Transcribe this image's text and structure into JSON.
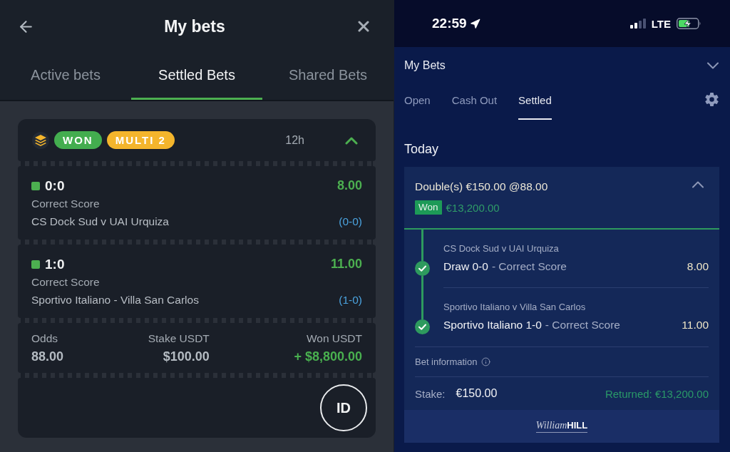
{
  "left_app": {
    "header": {
      "title": "My bets"
    },
    "tabs": [
      {
        "label": "Active bets",
        "selected": false
      },
      {
        "label": "Settled Bets",
        "selected": true
      },
      {
        "label": "Shared Bets",
        "selected": false
      }
    ],
    "bet_card": {
      "badges": [
        {
          "label": "WON",
          "color": "#43ad4f"
        },
        {
          "label": "MULTI 2",
          "color": "#f4b52c"
        }
      ],
      "time": "12h",
      "expanded": true,
      "selections": [
        {
          "pick": "0:0",
          "odds": "8.00",
          "market": "Correct Score",
          "event": "CS Dock Sud v UAI Urquiza",
          "result": "(0-0)"
        },
        {
          "pick": "1:0",
          "odds": "11.00",
          "market": "Correct Score",
          "event": "Sportivo Italiano - Villa San Carlos",
          "result": "(1-0)"
        }
      ],
      "summary": [
        {
          "label": "Odds",
          "value": "88.00",
          "kind": "plain"
        },
        {
          "label": "Stake USDT",
          "value": "$100.00",
          "kind": "plain"
        },
        {
          "label": "Won USDT",
          "value": "+ $8,800.00",
          "kind": "win"
        }
      ],
      "id_button": "ID"
    }
  },
  "right_app": {
    "status_bar": {
      "time": "22:59",
      "network": "LTE"
    },
    "header": {
      "title": "My Bets"
    },
    "tabs": [
      {
        "label": "Open",
        "selected": false
      },
      {
        "label": "Cash Out",
        "selected": false
      },
      {
        "label": "Settled",
        "selected": true
      }
    ],
    "section": "Today",
    "bet": {
      "title": "Double(s) €150.00 @88.00",
      "expanded": true,
      "status": "Won",
      "payout": "€13,200.00",
      "legs": [
        {
          "event": "CS Dock Sud v UAI Urquiza",
          "selection": "Draw 0-0",
          "market": "- Correct Score",
          "odds": "8.00"
        },
        {
          "event": "Sportivo Italiano v Villa San Carlos",
          "selection": "Sportivo Italiano 1-0",
          "market": "- Correct Score",
          "odds": "11.00"
        }
      ],
      "info_label": "Bet information",
      "stake_label": "Stake:",
      "stake": "€150.00",
      "returned": "Returned: €13,200.00"
    },
    "logo": {
      "script": "William",
      "bold": "HILL"
    }
  }
}
